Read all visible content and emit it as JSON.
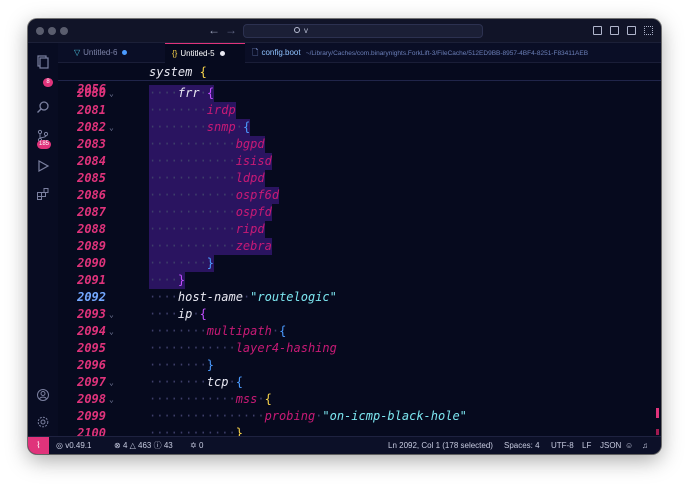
{
  "titlebar": {
    "search_value": "v"
  },
  "activity": {
    "explorer_badge": "8",
    "scm_badge": "185"
  },
  "tabs": [
    {
      "icon": "▽",
      "label": "Untitled-6",
      "icon_color": "#4cc3e0",
      "dot_color": "#4b9bff"
    },
    {
      "icon": "{}",
      "label": "Untitled-5",
      "icon_color": "#f7d34a",
      "dot_color": "#e8e8f2"
    },
    {
      "icon": "🗋",
      "label": "config.boot",
      "path": "~/Library/Caches/com.binarynights.ForkLift-3/FileCache/512ED9BB-8957-4BF4-8251-F83411AEB"
    }
  ],
  "editor": {
    "sticky": {
      "num": "2056",
      "text": "system",
      "brace": "{"
    },
    "lines": [
      {
        "num": "2080",
        "fold": true,
        "indent": 1,
        "text": "frr",
        "brace": "{",
        "braceClass": "br-p",
        "sel": true,
        "textClass": "kw"
      },
      {
        "num": "2081",
        "fold": false,
        "indent": 2,
        "text": "irdp",
        "sel": true,
        "textClass": "kw2"
      },
      {
        "num": "2082",
        "fold": true,
        "indent": 2,
        "text": "snmp",
        "brace": "{",
        "braceClass": "br-b",
        "sel": true,
        "textClass": "kw2"
      },
      {
        "num": "2083",
        "fold": false,
        "indent": 3,
        "text": "bgpd",
        "sel": true,
        "textClass": "kw2"
      },
      {
        "num": "2084",
        "fold": false,
        "indent": 3,
        "text": "isisd",
        "sel": true,
        "textClass": "kw2"
      },
      {
        "num": "2085",
        "fold": false,
        "indent": 3,
        "text": "ldpd",
        "sel": true,
        "textClass": "kw2"
      },
      {
        "num": "2086",
        "fold": false,
        "indent": 3,
        "text": "ospf6d",
        "sel": true,
        "textClass": "kw2"
      },
      {
        "num": "2087",
        "fold": false,
        "indent": 3,
        "text": "ospfd",
        "sel": true,
        "textClass": "kw2"
      },
      {
        "num": "2088",
        "fold": false,
        "indent": 3,
        "text": "ripd",
        "sel": true,
        "textClass": "kw2"
      },
      {
        "num": "2089",
        "fold": false,
        "indent": 3,
        "text": "zebra",
        "sel": true,
        "textClass": "kw2"
      },
      {
        "num": "2090",
        "fold": false,
        "indent": 2,
        "text": "",
        "brace": "}",
        "braceClass": "br-b",
        "sel": true
      },
      {
        "num": "2091",
        "fold": false,
        "indent": 1,
        "text": "",
        "brace": "}",
        "braceClass": "br-p",
        "sel": true
      },
      {
        "num": "2092",
        "fold": false,
        "indent": 1,
        "text": "host-name",
        "str": "\"routelogic\"",
        "current": true,
        "textClass": "kw"
      },
      {
        "num": "2093",
        "fold": true,
        "indent": 1,
        "text": "ip",
        "brace": "{",
        "braceClass": "br-p",
        "textClass": "kw"
      },
      {
        "num": "2094",
        "fold": true,
        "indent": 2,
        "text": "multipath",
        "brace": "{",
        "braceClass": "br-b",
        "textClass": "kw2"
      },
      {
        "num": "2095",
        "fold": false,
        "indent": 3,
        "text": "layer4-hashing",
        "textClass": "kw2"
      },
      {
        "num": "2096",
        "fold": false,
        "indent": 2,
        "text": "",
        "brace": "}",
        "braceClass": "br-b"
      },
      {
        "num": "2097",
        "fold": true,
        "indent": 2,
        "text": "tcp",
        "brace": "{",
        "braceClass": "br-b",
        "textClass": "kw"
      },
      {
        "num": "2098",
        "fold": true,
        "indent": 3,
        "text": "mss",
        "brace": "{",
        "braceClass": "br-y",
        "textClass": "kw2"
      },
      {
        "num": "2099",
        "fold": false,
        "indent": 4,
        "text": "probing",
        "str": "\"on-icmp-black-hole\"",
        "textClass": "kw2"
      },
      {
        "num": "2100",
        "fold": false,
        "indent": 3,
        "text": "",
        "brace": "}",
        "braceClass": "br-y"
      }
    ]
  },
  "status": {
    "version": "v0.49.1",
    "errors": "4",
    "warnings": "463",
    "infos": "43",
    "ports": "0",
    "position": "Ln 2092, Col 1 (178 selected)",
    "spaces": "Spaces: 4",
    "encoding": "UTF-8",
    "eol": "LF",
    "language": "JSON"
  }
}
